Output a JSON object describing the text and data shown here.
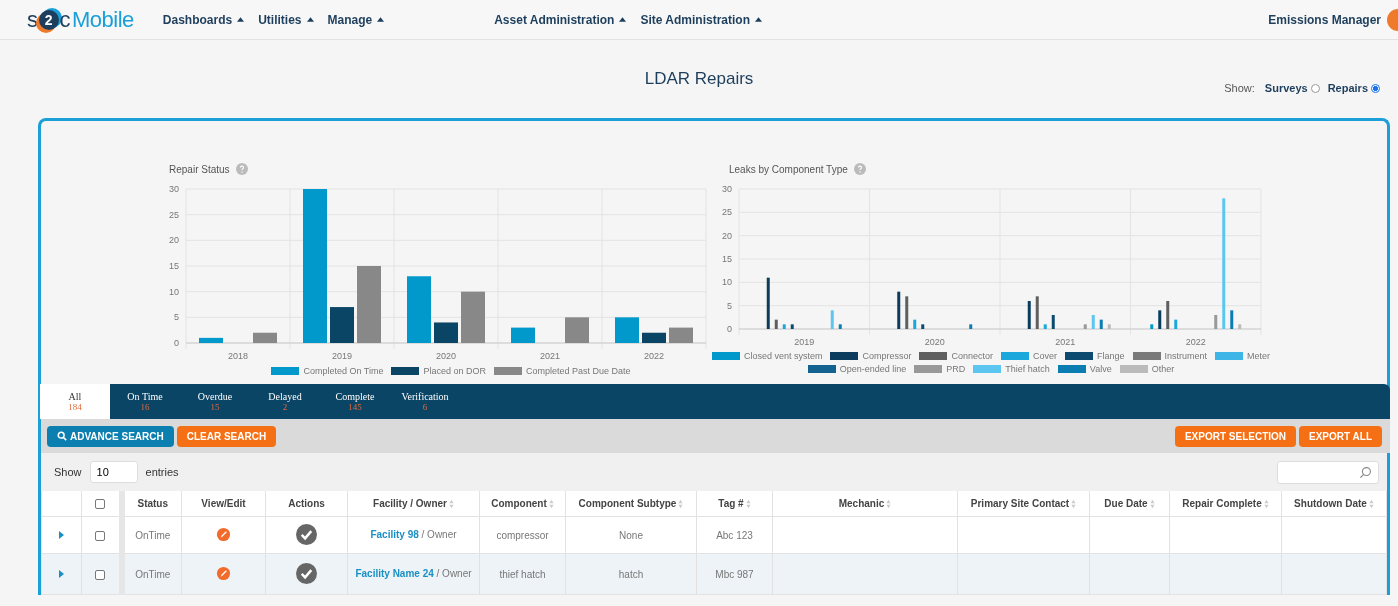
{
  "logo": {
    "prefix": "s",
    "badge": "2",
    "suffix": "c",
    "name": "Mobile"
  },
  "nav_left": [
    "Dashboards",
    "Utilities",
    "Manage"
  ],
  "nav_center": [
    "Asset Administration",
    "Site Administration"
  ],
  "user": {
    "name": "Emissions Manager"
  },
  "page_title": "LDAR Repairs",
  "show": {
    "label": "Show:",
    "options": [
      {
        "label": "Surveys",
        "selected": false
      },
      {
        "label": "Repairs",
        "selected": true
      }
    ]
  },
  "charts": [
    {
      "chart_data": {
        "type": "bar",
        "grid": true,
        "legend": true,
        "title": "Repair Status",
        "categories": [
          "2018",
          "2019",
          "2020",
          "2021",
          "2022"
        ],
        "ylim": [
          0,
          30
        ],
        "yticks": [
          0,
          5,
          10,
          15,
          20,
          25,
          30
        ],
        "series": [
          {
            "name": "Completed On Time",
            "color": "#0199cc",
            "values": [
              1,
              30,
              13,
              3,
              5
            ]
          },
          {
            "name": "Placed on DOR",
            "color": "#0b4566",
            "values": [
              0,
              7,
              4,
              0,
              2
            ]
          },
          {
            "name": "Completed Past Due Date",
            "color": "#888888",
            "values": [
              2,
              15,
              10,
              5,
              3
            ]
          }
        ]
      }
    },
    {
      "chart_data": {
        "type": "bar",
        "grid": true,
        "legend": true,
        "title": "Leaks by Component Type",
        "categories": [
          "2019",
          "2020",
          "2021",
          "2022"
        ],
        "ylim": [
          0,
          30
        ],
        "yticks": [
          0,
          5,
          10,
          15,
          20,
          25,
          30
        ],
        "series": [
          {
            "name": "Closed vent system",
            "color": "#0199cc",
            "values": [
              0,
              0,
              0,
              1
            ]
          },
          {
            "name": "Compressor",
            "color": "#0b3c5d",
            "values": [
              11,
              8,
              6,
              4
            ]
          },
          {
            "name": "Connector",
            "color": "#5f5f5f",
            "values": [
              2,
              7,
              7,
              6
            ]
          },
          {
            "name": "Cover",
            "color": "#1aa7dc",
            "values": [
              1,
              2,
              1,
              2
            ]
          },
          {
            "name": "Flange",
            "color": "#0d4a70",
            "values": [
              1,
              1,
              3,
              0
            ]
          },
          {
            "name": "Instrument",
            "color": "#7a7a7a",
            "values": [
              0,
              0,
              0,
              0
            ]
          },
          {
            "name": "Meter",
            "color": "#3db5e6",
            "values": [
              0,
              0,
              0,
              0
            ]
          },
          {
            "name": "Open-ended line",
            "color": "#14628f",
            "values": [
              0,
              0,
              0,
              0
            ]
          },
          {
            "name": "PRD",
            "color": "#999999",
            "values": [
              0,
              0,
              1,
              3
            ]
          },
          {
            "name": "Thief hatch",
            "color": "#5cc6f0",
            "values": [
              4,
              0,
              3,
              28
            ]
          },
          {
            "name": "Valve",
            "color": "#0a7db3",
            "values": [
              1,
              1,
              2,
              4
            ]
          },
          {
            "name": "Other",
            "color": "#bbbbbb",
            "values": [
              0,
              0,
              1,
              1
            ]
          }
        ]
      }
    }
  ],
  "tabs": [
    {
      "label": "All",
      "count": "184",
      "selected": true
    },
    {
      "label": "On Time",
      "count": "16",
      "selected": false
    },
    {
      "label": "Overdue",
      "count": "15",
      "selected": false
    },
    {
      "label": "Delayed",
      "count": "2",
      "selected": false
    },
    {
      "label": "Complete",
      "count": "145",
      "selected": false
    },
    {
      "label": "Verification",
      "count": "6",
      "selected": false
    }
  ],
  "toolbar": {
    "advance_search": "ADVANCE SEARCH",
    "clear_search": "CLEAR SEARCH",
    "export_selection": "EXPORT SELECTION",
    "export_all": "EXPORT ALL"
  },
  "entries": {
    "label_before": "Show",
    "value": "10",
    "label_after": "entries"
  },
  "table": {
    "select_all_checked": false,
    "columns": [
      {
        "label": "Status",
        "sortable": false
      },
      {
        "label": "View/Edit",
        "sortable": false
      },
      {
        "label": "Actions",
        "sortable": false
      },
      {
        "label": "Facility / Owner",
        "sortable": true
      },
      {
        "label": "Component",
        "sortable": true
      },
      {
        "label": "Component Subtype",
        "sortable": true
      },
      {
        "label": "Tag #",
        "sortable": true
      },
      {
        "label": "Mechanic",
        "sortable": true
      },
      {
        "label": "Primary Site Contact",
        "sortable": true
      },
      {
        "label": "Due Date",
        "sortable": true
      },
      {
        "label": "Repair Complete",
        "sortable": true
      },
      {
        "label": "Shutdown Date",
        "sortable": true
      }
    ],
    "rows": [
      {
        "checked": false,
        "status": "OnTime",
        "facility": "Facility 98",
        "owner": "/ Owner",
        "component": "compressor",
        "subtype": "None",
        "tag": "Abc 123"
      },
      {
        "checked": false,
        "status": "OnTime",
        "facility": "Facility Name 24",
        "owner": "/ Owner",
        "component": "thief hatch",
        "subtype": "hatch",
        "tag": "Mbc 987"
      }
    ]
  }
}
